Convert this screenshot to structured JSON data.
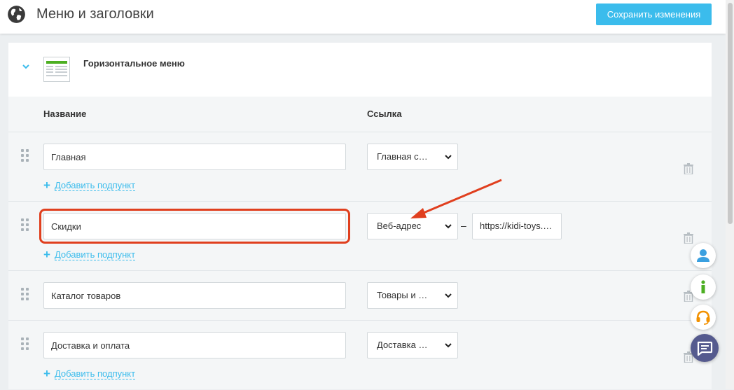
{
  "header": {
    "title": "Меню и заголовки",
    "save_label": "Сохранить изменения"
  },
  "panel": {
    "title": "Горизонтальное меню",
    "columns": {
      "name": "Название",
      "link": "Ссылка"
    }
  },
  "rows": [
    {
      "name": "Главная",
      "link_type": "Главная с…",
      "add_sub": "Добавить подпункт"
    },
    {
      "name": "Скидки",
      "link_type": "Веб-адрес",
      "url": "https://kidi-toys.…",
      "add_sub": "Добавить подпункт"
    },
    {
      "name": "Каталог товаров",
      "link_type": "Товары и …"
    },
    {
      "name": "Доставка и оплата",
      "link_type": "Доставка …",
      "add_sub": "Добавить подпункт"
    }
  ],
  "colors": {
    "accent": "#3bbcec",
    "highlight": "#e03f1e",
    "chat": "#555a8e",
    "info": "#4caf22",
    "support": "#f29100"
  },
  "icons": {
    "globe": "globe-icon",
    "chevron": "chevron-down-icon",
    "drag": "drag-handle-icon",
    "trash": "trash-icon",
    "user": "user-icon",
    "info": "info-icon",
    "support": "headset-icon",
    "chat": "chat-icon"
  }
}
